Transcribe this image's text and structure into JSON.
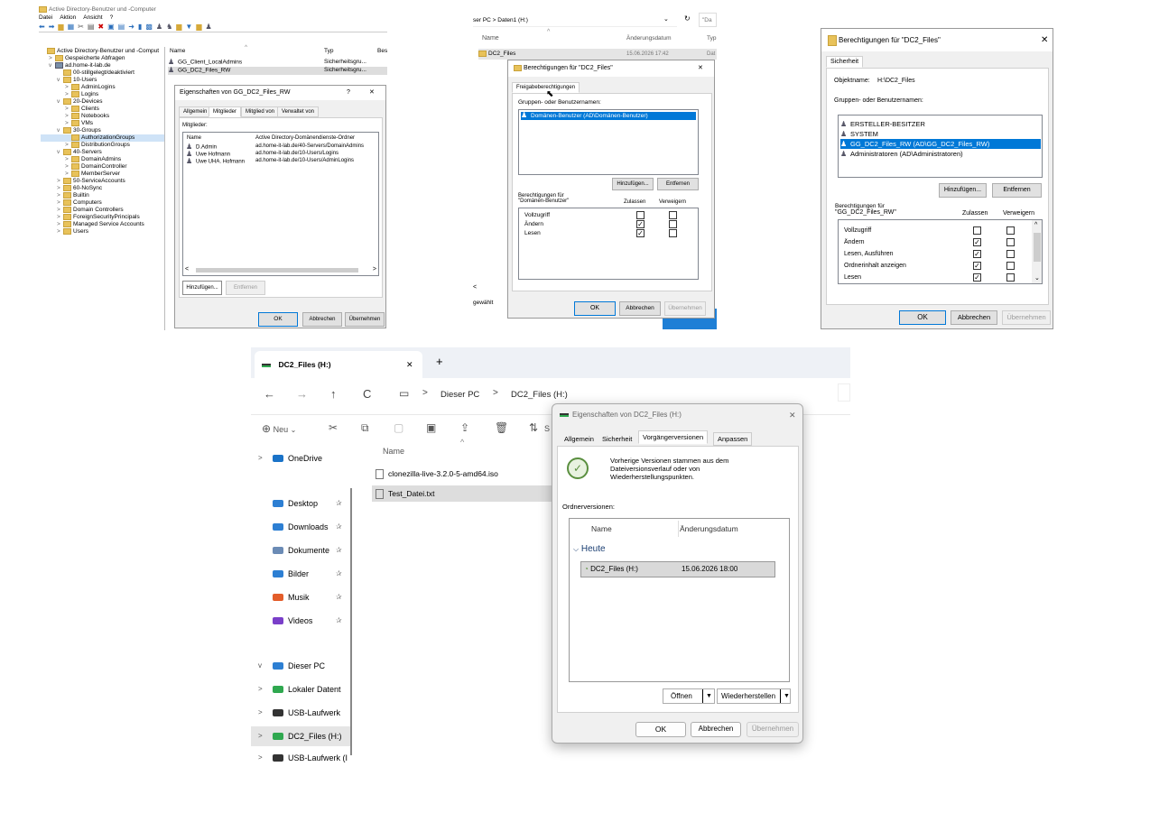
{
  "ad": {
    "title": "Active Directory-Benutzer und -Computer",
    "menu": [
      "Datei",
      "Aktion",
      "Ansicht",
      "?"
    ],
    "tree": [
      {
        "label": "Active Directory-Benutzer und -Comput",
        "indent": 0,
        "arrow": ""
      },
      {
        "label": "Gespeicherte Abfragen",
        "indent": 1,
        "arrow": ">"
      },
      {
        "label": "ad.home-it-lab.de",
        "indent": 1,
        "arrow": "v"
      },
      {
        "label": "00-stillgelegt/deaktiviert",
        "indent": 2,
        "arrow": ""
      },
      {
        "label": "10-Users",
        "indent": 2,
        "arrow": "v"
      },
      {
        "label": "AdminLogins",
        "indent": 3,
        "arrow": ">"
      },
      {
        "label": "Logins",
        "indent": 3,
        "arrow": ">"
      },
      {
        "label": "20-Devices",
        "indent": 2,
        "arrow": "v"
      },
      {
        "label": "Clients",
        "indent": 3,
        "arrow": ">"
      },
      {
        "label": "Notebooks",
        "indent": 3,
        "arrow": ">"
      },
      {
        "label": "VMs",
        "indent": 3,
        "arrow": ">"
      },
      {
        "label": "30-Groups",
        "indent": 2,
        "arrow": "v"
      },
      {
        "label": "AuthorizationGroups",
        "indent": 3,
        "arrow": "",
        "selected": true
      },
      {
        "label": "DistributionGroups",
        "indent": 3,
        "arrow": ">"
      },
      {
        "label": "40-Servers",
        "indent": 2,
        "arrow": "v"
      },
      {
        "label": "DomainAdmins",
        "indent": 3,
        "arrow": ">"
      },
      {
        "label": "DomainController",
        "indent": 3,
        "arrow": ">"
      },
      {
        "label": "MemberServer",
        "indent": 3,
        "arrow": ">"
      },
      {
        "label": "50-ServiceAccounts",
        "indent": 2,
        "arrow": ">"
      },
      {
        "label": "60-NoSync",
        "indent": 2,
        "arrow": ">"
      },
      {
        "label": "Builtin",
        "indent": 2,
        "arrow": ">"
      },
      {
        "label": "Computers",
        "indent": 2,
        "arrow": ">"
      },
      {
        "label": "Domain Controllers",
        "indent": 2,
        "arrow": ">"
      },
      {
        "label": "ForeignSecurityPrincipals",
        "indent": 2,
        "arrow": ">"
      },
      {
        "label": "Managed Service Accounts",
        "indent": 2,
        "arrow": ">"
      },
      {
        "label": "Users",
        "indent": 2,
        "arrow": ">"
      }
    ],
    "list_headers": [
      "Name",
      "Typ",
      "Bes"
    ],
    "list_rows": [
      {
        "name": "GG_Client_LocalAdmins",
        "type": "Sicherheitsgru..."
      },
      {
        "name": "GG_DC2_Files_RW",
        "type": "Sicherheitsgru..."
      }
    ],
    "props": {
      "title": "Eigenschaften von GG_DC2_Files_RW",
      "help": "?",
      "close": "✕",
      "tabs": [
        "Allgemein",
        "Mitglieder",
        "Mitglied von",
        "Verwaltet von"
      ],
      "members_label": "Mitglieder:",
      "col_name": "Name",
      "col_folder": "Active Directory-Domänendienste-Ordner",
      "members": [
        {
          "name": "D.Admin",
          "folder": "ad.home-it-lab.de/40-Servers/DomainAdmins"
        },
        {
          "name": "Uwe Hofmann",
          "folder": "ad.home-it-lab.de/10-Users/Logins"
        },
        {
          "name": "Uwe UHA. Hofmann",
          "folder": "ad.home-it-lab.de/10-Users/AdminLogins"
        }
      ],
      "add": "Hinzufügen...",
      "remove": "Entfernen",
      "ok": "OK",
      "cancel": "Abbrechen",
      "apply": "Übernehmen"
    }
  },
  "share": {
    "breadcrumb": "ser PC  >  Daten1 (H:)",
    "search": "\"Da",
    "col_name": "Name",
    "col_date": "Änderungsdatum",
    "col_type": "Typ",
    "row_name": "DC2_Files",
    "row_date": "15.06.2026 17:42",
    "row_type": "Dat",
    "status": "gewählt",
    "dialog": {
      "title": "Berechtigungen für \"DC2_Files\"",
      "close": "✕",
      "tab": "Freigabeberechtigungen",
      "groups_label": "Gruppen- oder Benutzernamen:",
      "group": "Domänen-Benutzer (AD\\Domänen-Benutzer)",
      "add": "Hinzufügen...",
      "remove": "Entfernen",
      "perm_label": "Berechtigungen für \"Domänen-Benutzer\"",
      "allow": "Zulassen",
      "deny": "Verweigern",
      "perms": [
        {
          "name": "Vollzugriff",
          "allow": "",
          "deny": ""
        },
        {
          "name": "Ändern",
          "allow": "✓",
          "deny": ""
        },
        {
          "name": "Lesen",
          "allow": "✓",
          "deny": ""
        }
      ],
      "ok": "OK",
      "cancel": "Abbrechen",
      "apply": "Übernehmen"
    }
  },
  "ntfs": {
    "title": "Berechtigungen für \"DC2_Files\"",
    "close": "✕",
    "tab": "Sicherheit",
    "object_label": "Objektname:",
    "object_value": "H:\\DC2_Files",
    "groups_label": "Gruppen- oder Benutzernamen:",
    "groups": [
      {
        "name": "ERSTELLER-BESITZER",
        "selected": false
      },
      {
        "name": "SYSTEM",
        "selected": false
      },
      {
        "name": "GG_DC2_Files_RW (AD\\GG_DC2_Files_RW)",
        "selected": true
      },
      {
        "name": "Administratoren (AD\\Administratoren)",
        "selected": false
      }
    ],
    "add": "Hinzufügen...",
    "remove": "Entfernen",
    "perm_label1": "Berechtigungen für",
    "perm_label2": "\"GG_DC2_Files_RW\"",
    "allow": "Zulassen",
    "deny": "Verweigern",
    "perms": [
      {
        "name": "Vollzugriff",
        "allow": "",
        "deny": ""
      },
      {
        "name": "Ändern",
        "allow": "✓",
        "deny": ""
      },
      {
        "name": "Lesen, Ausführen",
        "allow": "✓",
        "deny": ""
      },
      {
        "name": "Ordnerinhalt anzeigen",
        "allow": "✓",
        "deny": ""
      },
      {
        "name": "Lesen",
        "allow": "✓",
        "deny": ""
      }
    ],
    "ok": "OK",
    "cancel": "Abbrechen",
    "apply": "Übernehmen"
  },
  "explorer": {
    "tab_title": "DC2_Files (H:)",
    "tab_close": "✕",
    "tab_new": "+",
    "crumbs": [
      "Dieser PC",
      "DC2_Files (H:)"
    ],
    "new_label": "Neu",
    "sort_label": "S",
    "nav": [
      {
        "label": "OneDrive",
        "icon": "onedrive-icon",
        "arrow": ">",
        "pin": ""
      },
      {
        "label": "Desktop",
        "icon": "desktop-icon",
        "arrow": "",
        "pin": "✰"
      },
      {
        "label": "Downloads",
        "icon": "download-icon",
        "arrow": "",
        "pin": "✰"
      },
      {
        "label": "Dokumente",
        "icon": "document-icon",
        "arrow": "",
        "pin": "✰"
      },
      {
        "label": "Bilder",
        "icon": "pictures-icon",
        "arrow": "",
        "pin": "✰"
      },
      {
        "label": "Musik",
        "icon": "music-icon",
        "arrow": "",
        "pin": "✰"
      },
      {
        "label": "Videos",
        "icon": "video-icon",
        "arrow": "",
        "pin": "✰"
      },
      {
        "label": "Dieser PC",
        "icon": "pc-icon",
        "arrow": "v",
        "pin": ""
      },
      {
        "label": "Lokaler Datent",
        "icon": "drive-icon",
        "arrow": ">",
        "pin": ""
      },
      {
        "label": "USB-Laufwerk",
        "icon": "usb-icon",
        "arrow": ">",
        "pin": ""
      },
      {
        "label": "DC2_Files (H:)",
        "icon": "drive-icon",
        "arrow": ">",
        "pin": "",
        "selected": true
      },
      {
        "label": "USB-Laufwerk (I",
        "icon": "usb-icon",
        "arrow": ">",
        "pin": ""
      }
    ],
    "col_name": "Name",
    "files": [
      {
        "name": "clonezilla-live-3.2.0-5-amd64.iso",
        "selected": false
      },
      {
        "name": "Test_Datei.txt",
        "selected": true
      }
    ]
  },
  "prev": {
    "title": "Eigenschaften von DC2_Files (H:)",
    "close": "✕",
    "tabs": [
      "Allgemein",
      "Sicherheit",
      "Vorgängerversionen",
      "Anpassen"
    ],
    "info": "Vorherige Versionen stammen aus dem Dateiversionsverlauf oder von Wiederherstellungspunkten.",
    "versions_label": "Ordnerversionen:",
    "col_name": "Name",
    "col_date": "Änderungsdatum",
    "group": "Heute",
    "row_name": "DC2_Files (H:)",
    "row_date": "15.06.2026 18:00",
    "open": "Öffnen",
    "restore": "Wiederherstellen",
    "ok": "OK",
    "cancel": "Abbrechen",
    "apply": "Übernehmen"
  }
}
